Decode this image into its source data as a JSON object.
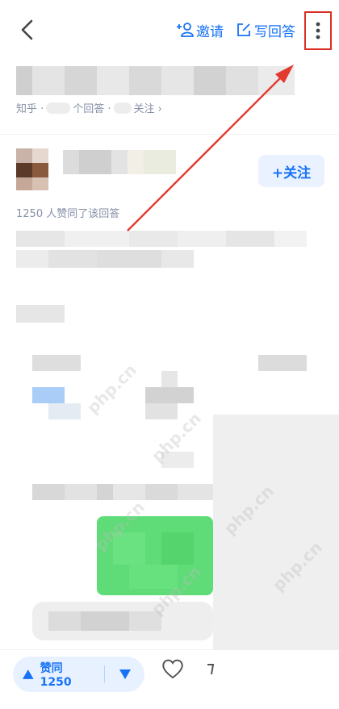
{
  "header": {
    "invite_label": "邀请",
    "write_answer_label": "写回答"
  },
  "question": {
    "meta_source": "知乎 ·",
    "meta_answers": "个回答 ·",
    "meta_follow": "关注 ›"
  },
  "answer": {
    "follow_label": "+关注",
    "voters_text": "1250 人赞同了该回答"
  },
  "bottom": {
    "vote_label": "赞同 1250"
  },
  "watermark": "php.cn",
  "colors": {
    "accent": "#1772f6",
    "highlight": "#d93025",
    "green_block": "#5fdc77"
  }
}
